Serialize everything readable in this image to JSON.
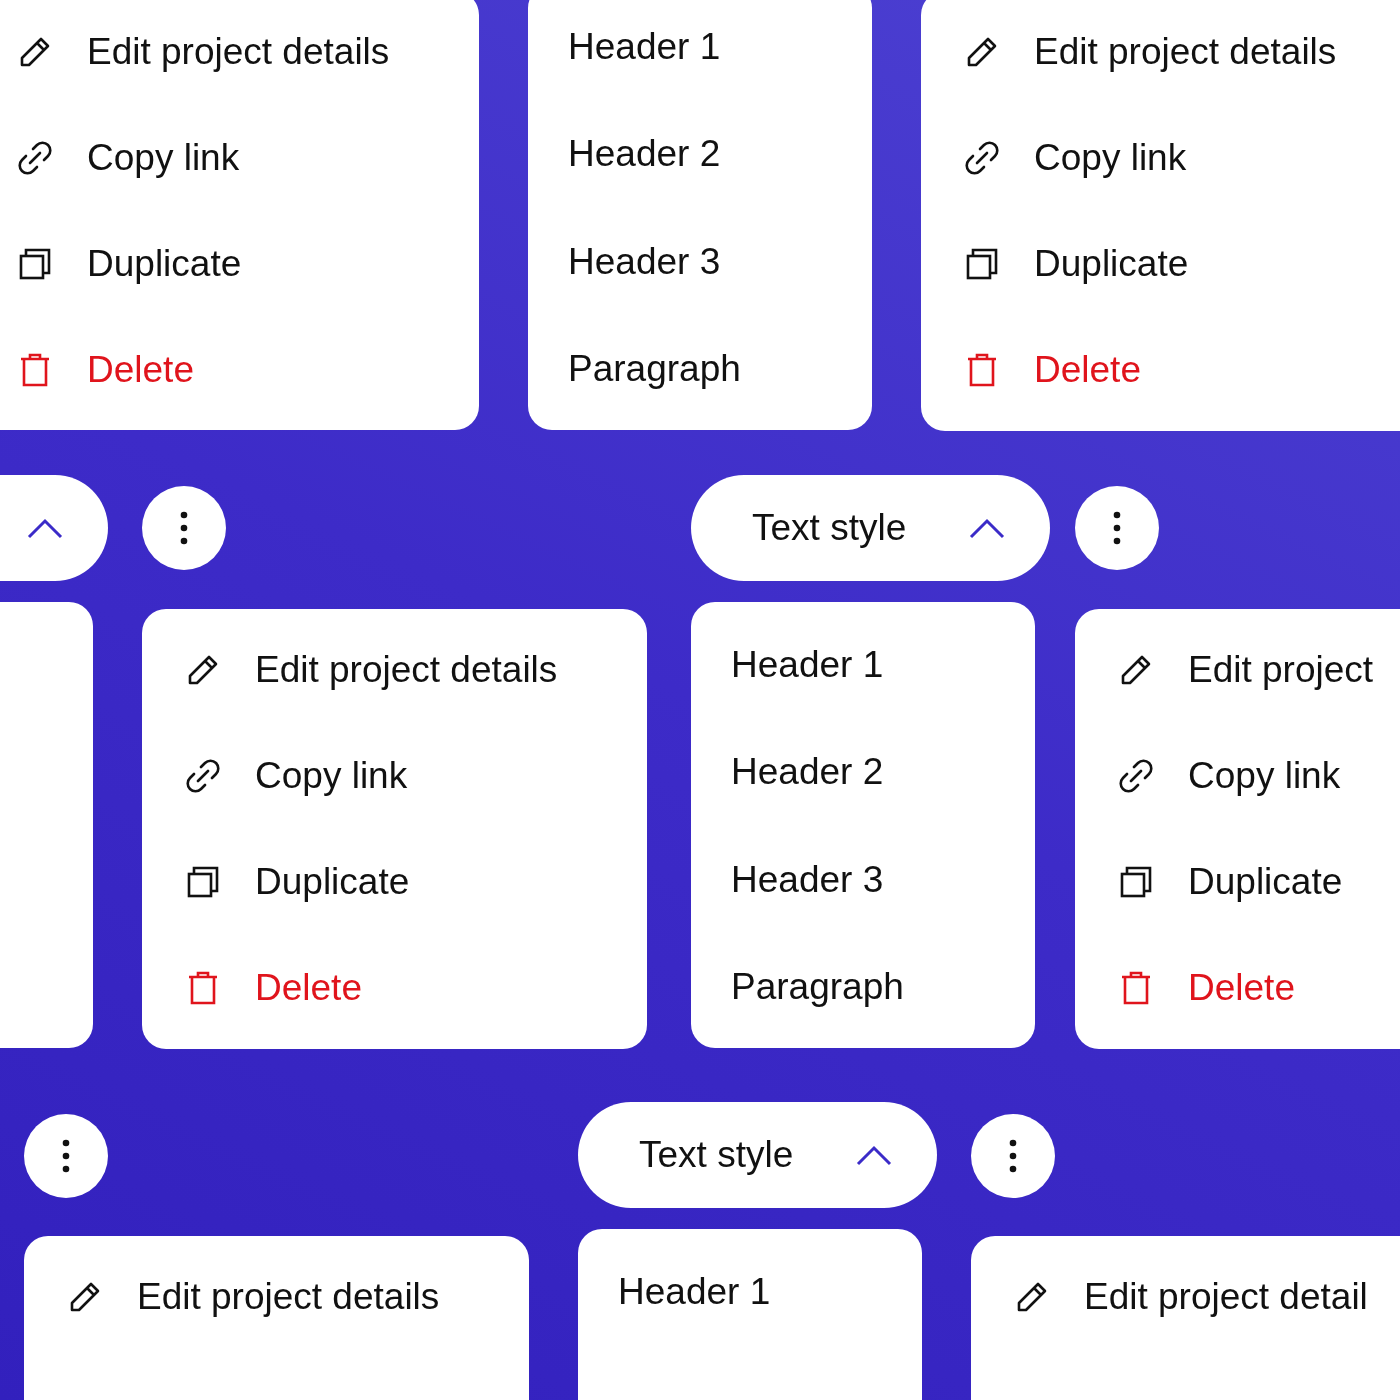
{
  "panels": [
    {
      "kind": "actions_menu",
      "items": [
        {
          "kind": "edit",
          "label": "Edit project details"
        },
        {
          "kind": "link",
          "label": "Copy link"
        },
        {
          "kind": "duplicate",
          "label": "Duplicate"
        },
        {
          "kind": "delete",
          "label": "Delete"
        }
      ]
    },
    {
      "kind": "text_style_menu",
      "items": [
        {
          "label": "Header 1"
        },
        {
          "label": "Header 2"
        },
        {
          "label": "Header 3"
        },
        {
          "label": "Paragraph"
        }
      ]
    },
    {
      "kind": "actions_menu",
      "items": [
        {
          "kind": "edit",
          "label": "Edit project details"
        },
        {
          "kind": "link",
          "label": "Copy link"
        },
        {
          "kind": "duplicate",
          "label": "Duplicate"
        },
        {
          "kind": "delete",
          "label": "Delete"
        }
      ]
    },
    {
      "kind": "dropdown_pill",
      "expanded": true
    },
    {
      "kind": "more_button"
    },
    {
      "kind": "dropdown_pill",
      "label": "Text style",
      "expanded": true
    },
    {
      "kind": "more_button"
    },
    {
      "kind": "blank_card"
    },
    {
      "kind": "actions_menu",
      "items": [
        {
          "kind": "edit",
          "label": "Edit project details"
        },
        {
          "kind": "link",
          "label": "Copy link"
        },
        {
          "kind": "duplicate",
          "label": "Duplicate"
        },
        {
          "kind": "delete",
          "label": "Delete"
        }
      ]
    },
    {
      "kind": "text_style_menu",
      "items": [
        {
          "label": "Header 1"
        },
        {
          "label": "Header 2"
        },
        {
          "label": "Header 3"
        },
        {
          "label": "Paragraph"
        }
      ]
    },
    {
      "kind": "actions_menu",
      "items": [
        {
          "kind": "edit",
          "label": "Edit project"
        },
        {
          "kind": "link",
          "label": "Copy link"
        },
        {
          "kind": "duplicate",
          "label": "Duplicate"
        },
        {
          "kind": "delete",
          "label": "Delete"
        }
      ]
    },
    {
      "kind": "more_button"
    },
    {
      "kind": "dropdown_pill",
      "label": "Text style",
      "expanded": true
    },
    {
      "kind": "more_button"
    },
    {
      "kind": "actions_menu",
      "items": [
        {
          "kind": "edit",
          "label": "Edit project details"
        }
      ]
    },
    {
      "kind": "text_style_menu",
      "items": [
        {
          "label": "Header 1"
        }
      ]
    },
    {
      "kind": "actions_menu",
      "items": [
        {
          "kind": "edit",
          "label": "Edit project detail"
        }
      ]
    }
  ]
}
